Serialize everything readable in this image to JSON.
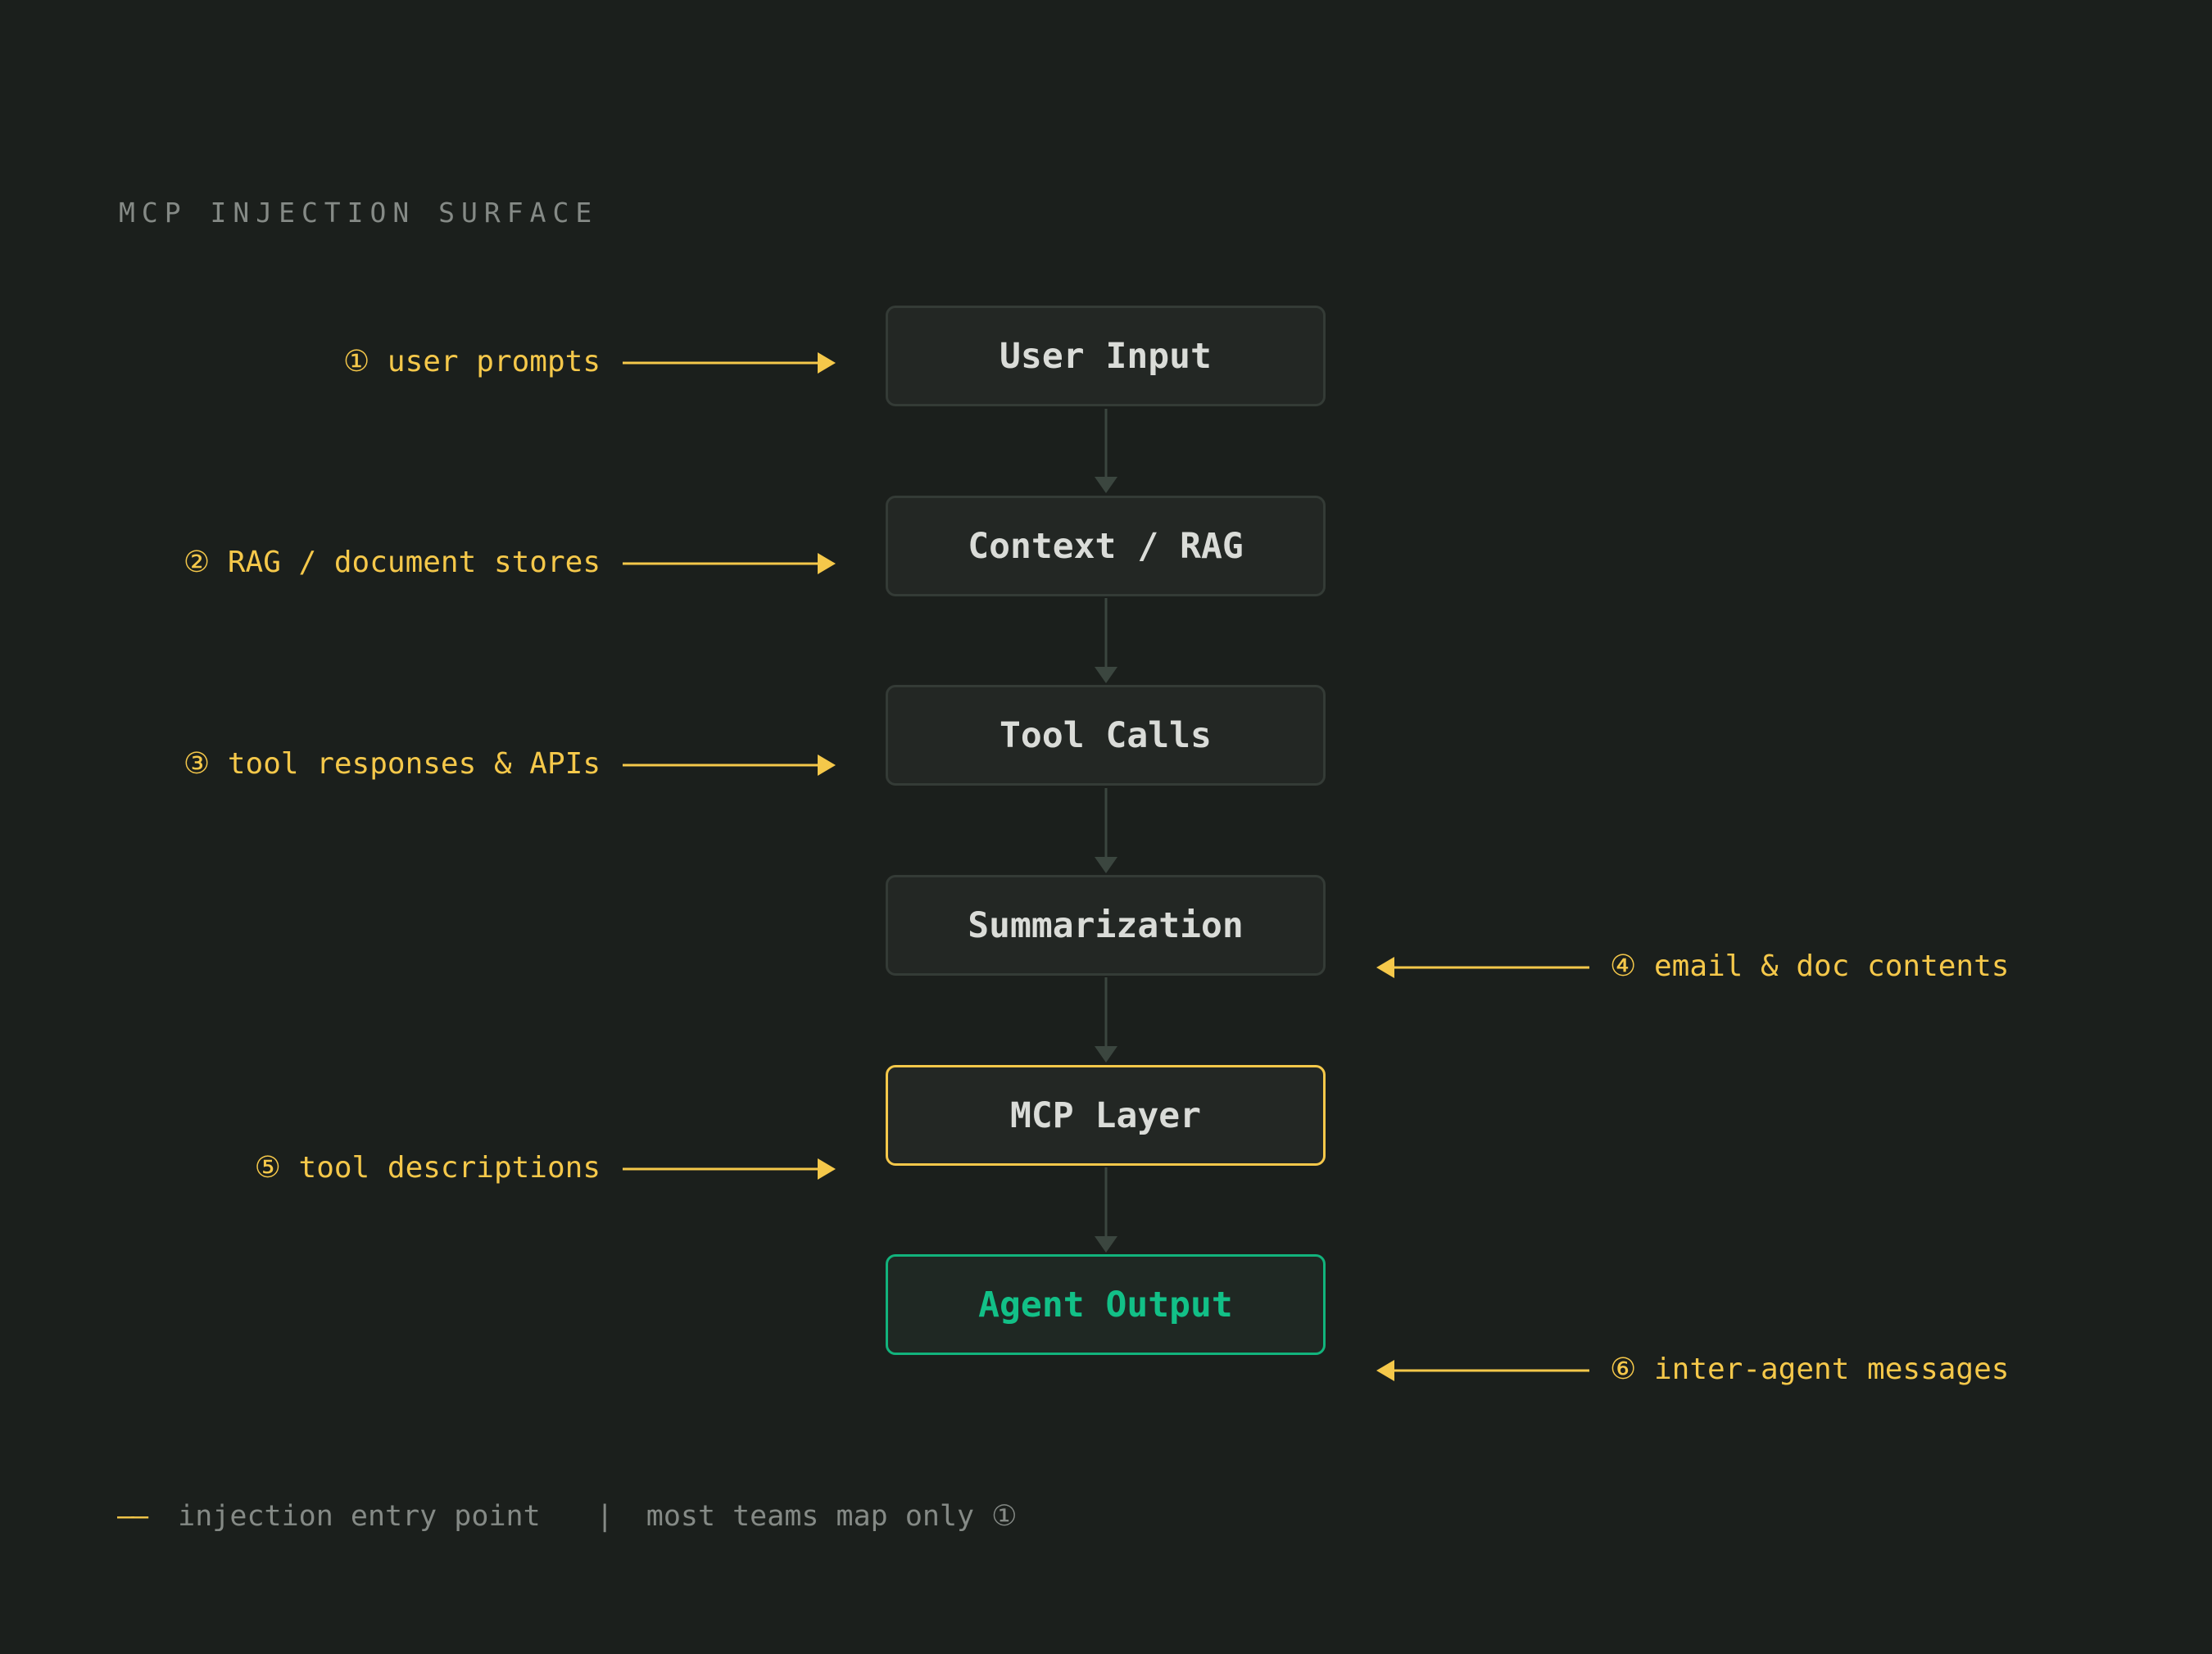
{
  "title": "MCP INJECTION SURFACE",
  "pipeline": [
    "User Input",
    "Context / RAG",
    "Tool Calls",
    "Summarization",
    "MCP Layer",
    "Agent Output"
  ],
  "injection_points": [
    {
      "marker": "①",
      "text": "user prompts",
      "side": "left"
    },
    {
      "marker": "②",
      "text": "RAG / document stores",
      "side": "left"
    },
    {
      "marker": "③",
      "text": "tool responses & APIs",
      "side": "left"
    },
    {
      "marker": "④",
      "text": "email & doc contents",
      "side": "right"
    },
    {
      "marker": "⑤",
      "text": "tool descriptions",
      "side": "left"
    },
    {
      "marker": "⑥",
      "text": "inter-agent messages",
      "side": "right"
    }
  ],
  "legend": {
    "dash": "——",
    "entry_label": "injection entry point",
    "separator": "|",
    "note": "most teams map only ①"
  },
  "colors": {
    "background": "#1b1f1c",
    "injection": "#f5c84a",
    "output": "#12c087",
    "connector": "#3b463f"
  }
}
